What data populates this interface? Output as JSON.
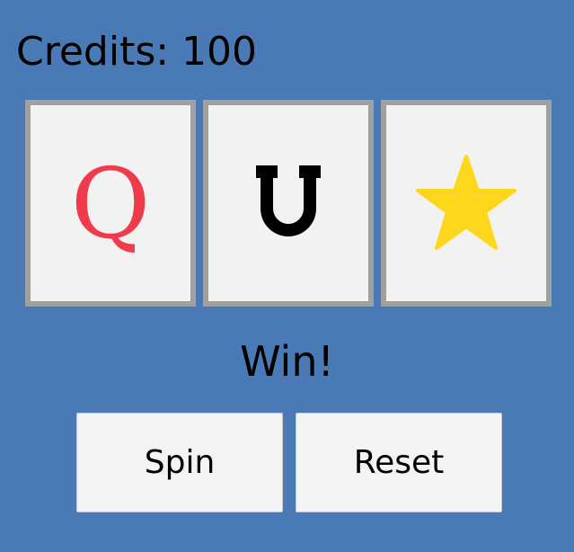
{
  "credits": {
    "text": "Credits: 100"
  },
  "reels": [
    {
      "symbol": "Q",
      "icon": "queen-q-icon",
      "color": "#ef3b4a"
    },
    {
      "symbol": "",
      "icon": "horseshoe-icon",
      "color": "#000000"
    },
    {
      "symbol": "",
      "icon": "star-icon",
      "color": "#fdd71c"
    }
  ],
  "result": {
    "text": "Win!"
  },
  "buttons": {
    "spin_label": "Spin",
    "reset_label": "Reset"
  }
}
